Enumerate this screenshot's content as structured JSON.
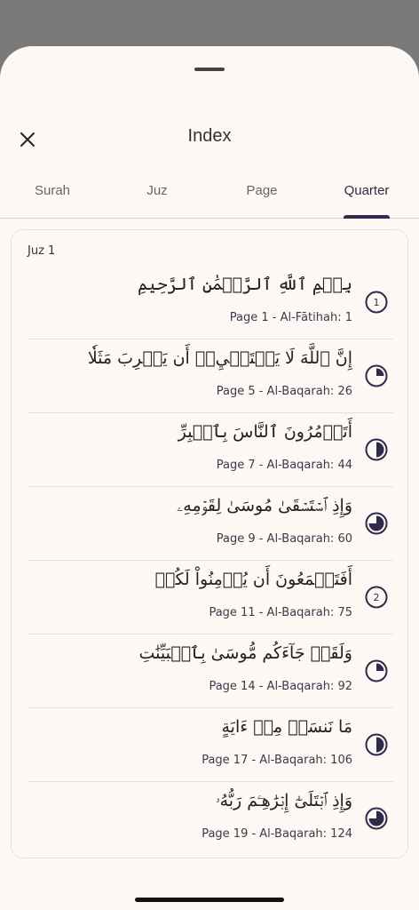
{
  "header": {
    "title": "Index"
  },
  "tabs": [
    {
      "label": "Surah",
      "active": false
    },
    {
      "label": "Juz",
      "active": false
    },
    {
      "label": "Page",
      "active": false
    },
    {
      "label": "Quarter",
      "active": true
    }
  ],
  "section": {
    "label": "Juz 1"
  },
  "accent_color": "#2f2b4d",
  "rows": [
    {
      "arabic": "بِسۡمِ ٱللَّهِ ٱلرَّحۡمَٰنِ ٱلرَّحِيمِ",
      "meta": "Page 1 - Al-Fātihah: 1",
      "icon": "juz-number-icon",
      "number": "1",
      "fraction": 0
    },
    {
      "arabic": "إِنَّ ٱللَّهَ لَا يَسۡتَحۡيِۦٓ أَن يَضۡرِبَ مَثَلٗا",
      "meta": "Page 5 - Al-Baqarah: 26",
      "icon": "quarter-icon",
      "number": "",
      "fraction": 0.25
    },
    {
      "arabic": "أَتَأۡمُرُونَ ٱلنَّاسَ بِٱلۡبِرِّ",
      "meta": "Page 7 - Al-Baqarah: 44",
      "icon": "half-icon",
      "number": "",
      "fraction": 0.5
    },
    {
      "arabic": "وَإِذِ ٱسۡتَسۡقَىٰ مُوسَىٰ لِقَوۡمِهِۦ",
      "meta": "Page 9 - Al-Baqarah: 60",
      "icon": "three-quarter-icon",
      "number": "",
      "fraction": 0.75
    },
    {
      "arabic": "أَفَتَطۡمَعُونَ أَن يُؤۡمِنُواْ لَكُمۡ",
      "meta": "Page 11 - Al-Baqarah: 75",
      "icon": "juz-number-icon",
      "number": "2",
      "fraction": 0
    },
    {
      "arabic": "وَلَقَدۡ جَآءَكُم مُّوسَىٰ بِٱلۡبَيِّنَٰتِ",
      "meta": "Page 14 - Al-Baqarah: 92",
      "icon": "quarter-icon",
      "number": "",
      "fraction": 0.25
    },
    {
      "arabic": "مَا نَنسَخۡ مِنۡ ءَايَةٍ",
      "meta": "Page 17 - Al-Baqarah: 106",
      "icon": "half-icon",
      "number": "",
      "fraction": 0.5
    },
    {
      "arabic": "وَإِذِ ٱبۡتَلَىٰٓ إِبۡرَٰهِـۧمَ رَبُّهُۥ",
      "meta": "Page 19 - Al-Baqarah: 124",
      "icon": "three-quarter-icon",
      "number": "",
      "fraction": 0.75
    }
  ]
}
